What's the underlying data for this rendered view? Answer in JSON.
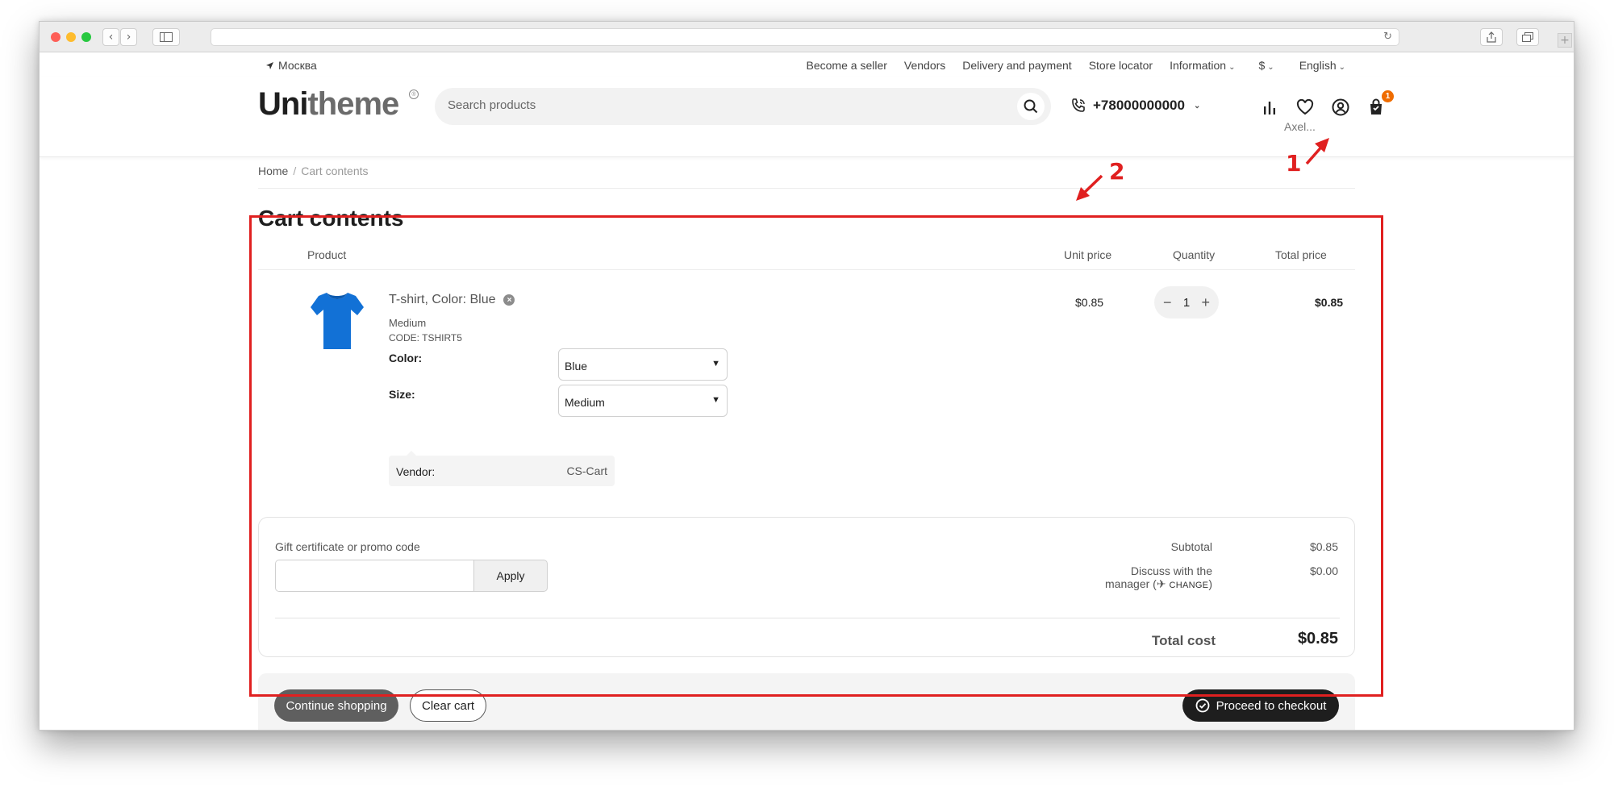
{
  "colors": {
    "annotation": "#e02020",
    "cart_badge": "#ef6c00",
    "checkout_button": "#1e1e1e",
    "continue_button": "#5f5f5f",
    "product_tshirt": "#1271d6"
  },
  "topbar": {
    "location": "Москва",
    "links": [
      "Become a seller",
      "Vendors",
      "Delivery and payment",
      "Store locator"
    ],
    "information": "Information",
    "currency": "$",
    "language": "English"
  },
  "header": {
    "logo_bold": "Uni",
    "logo_light": "theme",
    "search_placeholder": "Search products",
    "phone": "+78000000000",
    "user_name": "Axel...",
    "cart_count": "1"
  },
  "breadcrumb": {
    "home": "Home",
    "separator": "/",
    "current": "Cart contents"
  },
  "page_title": "Cart contents",
  "cart": {
    "columns": {
      "product": "Product",
      "unit_price": "Unit price",
      "quantity": "Quantity",
      "total_price": "Total price"
    },
    "item": {
      "title": "T-shirt, Color: Blue",
      "variant": "Medium",
      "code": "CODE: TSHIRT5",
      "color_label": "Color:",
      "color_value": "Blue",
      "size_label": "Size:",
      "size_value": "Medium",
      "vendor_label": "Vendor:",
      "vendor_value": "CS-Cart",
      "unit_price": "$0.85",
      "quantity": "1",
      "total_price": "$0.85"
    }
  },
  "summary": {
    "promo_label": "Gift certificate or promo code",
    "apply": "Apply",
    "subtotal_label": "Subtotal",
    "subtotal_value": "$0.85",
    "discuss_line1": "Discuss with the",
    "discuss_line2": "manager (",
    "change": "CHANGE",
    "discuss_close": ")",
    "discuss_value": "$0.00",
    "total_label": "Total cost",
    "total_value": "$0.85"
  },
  "actions": {
    "continue": "Continue shopping",
    "clear": "Clear cart",
    "checkout": "Proceed to checkout"
  },
  "annotations": {
    "one": "1",
    "two": "2"
  }
}
